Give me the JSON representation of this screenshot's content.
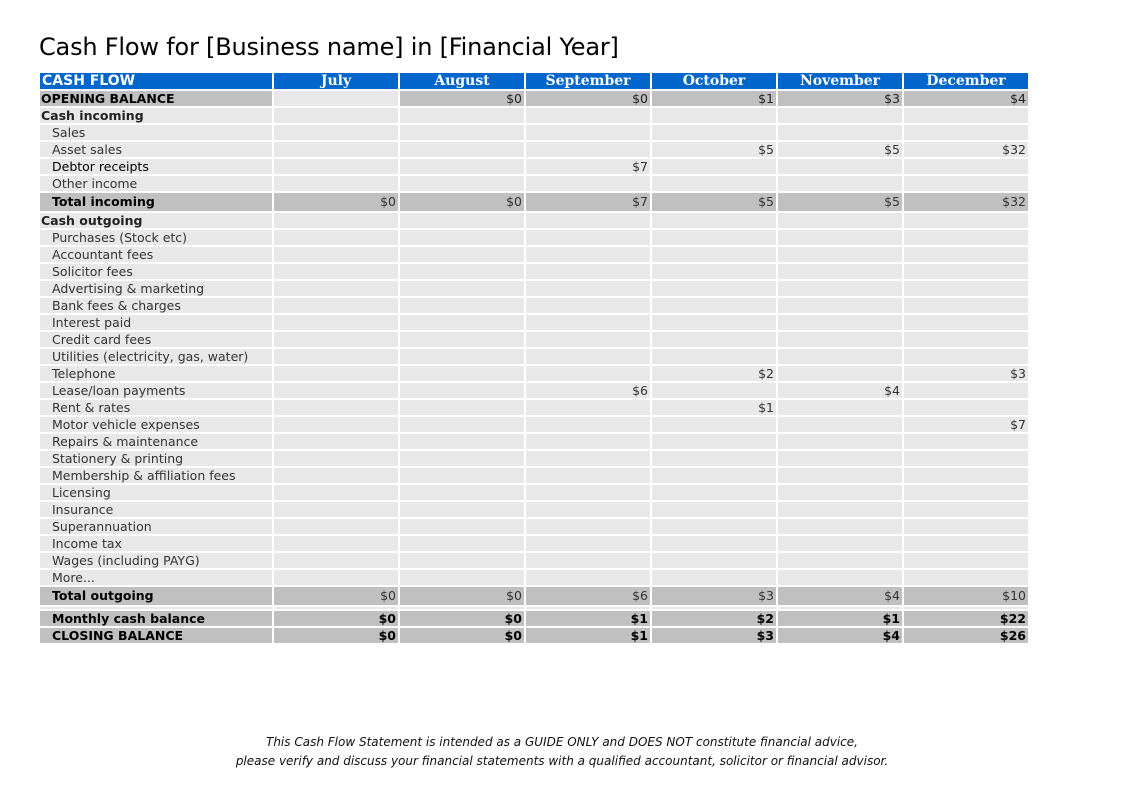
{
  "page": {
    "title": "Cash Flow for [Business name] in [Financial Year]"
  },
  "table": {
    "header_label": "CASH FLOW",
    "months": [
      "July",
      "August",
      "September",
      "October",
      "November",
      "December"
    ],
    "opening_balance": {
      "label": "OPENING BALANCE",
      "values": [
        "",
        "$0",
        "$0",
        "$1",
        "$3",
        "$4"
      ]
    },
    "cash_incoming": {
      "label": "Cash incoming",
      "rows": [
        {
          "label": "Sales",
          "values": [
            "",
            "",
            "",
            "",
            "",
            ""
          ]
        },
        {
          "label": "Asset sales",
          "values": [
            "",
            "",
            "",
            "$5",
            "$5",
            "$32"
          ]
        },
        {
          "label": "Debtor receipts",
          "values": [
            "",
            "",
            "$7",
            "",
            "",
            ""
          ]
        },
        {
          "label": "Other income",
          "values": [
            "",
            "",
            "",
            "",
            "",
            ""
          ]
        }
      ],
      "total_label": "Total incoming",
      "total_values": [
        "$0",
        "$0",
        "$7",
        "$5",
        "$5",
        "$32"
      ]
    },
    "cash_outgoing": {
      "label": "Cash outgoing",
      "rows": [
        {
          "label": "Purchases (Stock etc)",
          "values": [
            "",
            "",
            "",
            "",
            "",
            ""
          ]
        },
        {
          "label": "Accountant fees",
          "values": [
            "",
            "",
            "",
            "",
            "",
            ""
          ]
        },
        {
          "label": "Solicitor fees",
          "values": [
            "",
            "",
            "",
            "",
            "",
            ""
          ]
        },
        {
          "label": "Advertising & marketing",
          "values": [
            "",
            "",
            "",
            "",
            "",
            ""
          ]
        },
        {
          "label": "Bank fees & charges",
          "values": [
            "",
            "",
            "",
            "",
            "",
            ""
          ]
        },
        {
          "label": "Interest paid",
          "values": [
            "",
            "",
            "",
            "",
            "",
            ""
          ]
        },
        {
          "label": "Credit card fees",
          "values": [
            "",
            "",
            "",
            "",
            "",
            ""
          ]
        },
        {
          "label": "Utilities (electricity, gas, water)",
          "values": [
            "",
            "",
            "",
            "",
            "",
            ""
          ]
        },
        {
          "label": "Telephone",
          "values": [
            "",
            "",
            "",
            "$2",
            "",
            "$3"
          ]
        },
        {
          "label": "Lease/loan payments",
          "values": [
            "",
            "",
            "$6",
            "",
            "$4",
            ""
          ]
        },
        {
          "label": "Rent & rates",
          "values": [
            "",
            "",
            "",
            "$1",
            "",
            ""
          ]
        },
        {
          "label": "Motor vehicle expenses",
          "values": [
            "",
            "",
            "",
            "",
            "",
            "$7"
          ]
        },
        {
          "label": "Repairs & maintenance",
          "values": [
            "",
            "",
            "",
            "",
            "",
            ""
          ]
        },
        {
          "label": "Stationery & printing",
          "values": [
            "",
            "",
            "",
            "",
            "",
            ""
          ]
        },
        {
          "label": "Membership & affiliation fees",
          "values": [
            "",
            "",
            "",
            "",
            "",
            ""
          ]
        },
        {
          "label": "Licensing",
          "values": [
            "",
            "",
            "",
            "",
            "",
            ""
          ]
        },
        {
          "label": "Insurance",
          "values": [
            "",
            "",
            "",
            "",
            "",
            ""
          ]
        },
        {
          "label": "Superannuation",
          "values": [
            "",
            "",
            "",
            "",
            "",
            ""
          ]
        },
        {
          "label": "Income tax",
          "values": [
            "",
            "",
            "",
            "",
            "",
            ""
          ]
        },
        {
          "label": "Wages (including PAYG)",
          "values": [
            "",
            "",
            "",
            "",
            "",
            ""
          ]
        },
        {
          "label": "More...",
          "values": [
            "",
            "",
            "",
            "",
            "",
            ""
          ]
        }
      ],
      "total_label": "Total outgoing",
      "total_values": [
        "$0",
        "$0",
        "$6",
        "$3",
        "$4",
        "$10"
      ]
    },
    "monthly_cash_balance": {
      "label": "Monthly cash balance",
      "values": [
        "$0",
        "$0",
        "$1",
        "$2",
        "$1",
        "$22"
      ]
    },
    "closing_balance": {
      "label": "CLOSING BALANCE",
      "values": [
        "$0",
        "$0",
        "$1",
        "$3",
        "$4",
        "$26"
      ]
    }
  },
  "footer": {
    "line1": "This Cash Flow Statement is intended as a GUIDE ONLY and DOES NOT constitute financial advice,",
    "line2": "please verify and discuss your financial statements with a qualified accountant, solicitor or financial advisor."
  },
  "colors": {
    "header_blue": "#0066cc",
    "row_light": "#e8e8e8",
    "row_dark": "#c0c0c0"
  }
}
